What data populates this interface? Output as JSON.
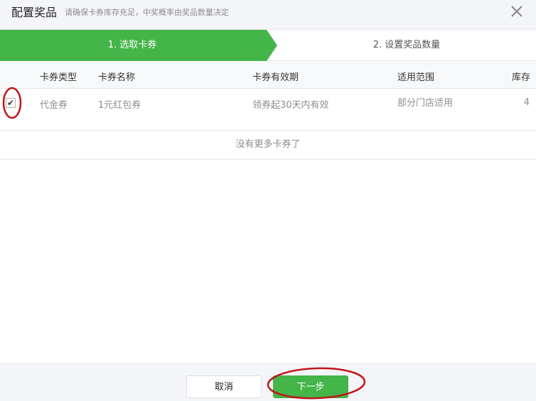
{
  "header": {
    "title": "配置奖品",
    "subtitle": "请确保卡券库存充足，中奖概率由奖品数量决定",
    "close_icon": "close-icon"
  },
  "steps": {
    "step1": "1. 选取卡券",
    "step2": "2. 设置奖品数量",
    "active_color": "#44b549"
  },
  "table": {
    "columns": {
      "type": "卡券类型",
      "name": "卡券名称",
      "valid": "卡券有效期",
      "scope": "适用范围",
      "stock": "库存"
    },
    "rows": [
      {
        "checked": true,
        "type": "代金券",
        "name": "1元红包券",
        "valid": "领券起30天内有效",
        "scope": "部分门店适用",
        "stock": "4"
      }
    ],
    "empty_more": "没有更多卡券了"
  },
  "footer": {
    "cancel_label": "取消",
    "next_label": "下一步"
  },
  "annotation_color": "#c0151b"
}
